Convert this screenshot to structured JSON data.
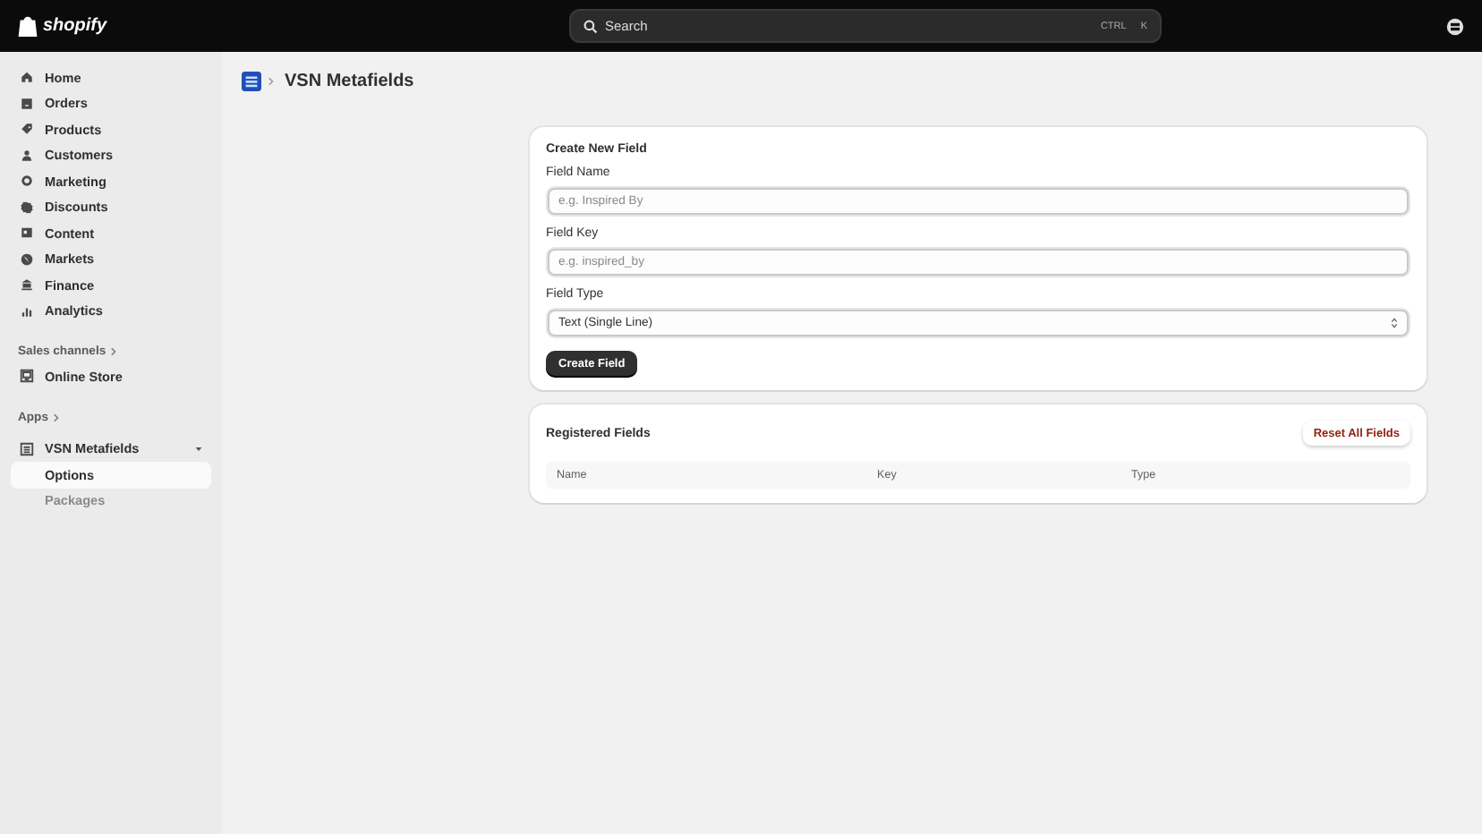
{
  "topbar": {
    "logo": "shopify",
    "search": {
      "placeholder": "Search",
      "shortcut": [
        "CTRL",
        "K"
      ]
    }
  },
  "sidebar": {
    "items": [
      {
        "label": "Home",
        "selected": false
      },
      {
        "label": "Orders",
        "selected": false
      },
      {
        "label": "Products",
        "selected": false
      },
      {
        "label": "Customers",
        "selected": false
      },
      {
        "label": "Marketing",
        "selected": false
      },
      {
        "label": "Discounts",
        "selected": false
      },
      {
        "label": "Content",
        "selected": false
      },
      {
        "label": "Markets",
        "selected": false
      },
      {
        "label": "Finance",
        "selected": false
      },
      {
        "label": "Analytics",
        "selected": false
      }
    ],
    "sales_channels": {
      "heading": "Sales channels",
      "items": [
        {
          "label": "Online Store",
          "selected": false
        }
      ]
    },
    "apps": {
      "heading": "Apps",
      "app": {
        "label": "VSN Metafields",
        "expanded": true,
        "children": [
          {
            "label": "Options",
            "selected": true
          },
          {
            "label": "Packages",
            "selected": false
          }
        ]
      }
    }
  },
  "page": {
    "title": "VSN Metafields",
    "create_card": {
      "title": "Create New Field",
      "fields": [
        {
          "kind": "input",
          "label": "Field Name",
          "placeholder": "e.g. Inspired By"
        },
        {
          "kind": "input",
          "label": "Field Key",
          "placeholder": "e.g. inspired_by"
        },
        {
          "kind": "select",
          "label": "Field Type",
          "value": "Text (Single Line)"
        }
      ],
      "button": "Create Field"
    },
    "registered_card": {
      "title": "Registered Fields",
      "reset_button": "Reset All Fields",
      "columns": [
        "Name",
        "Key",
        "Type"
      ]
    }
  }
}
